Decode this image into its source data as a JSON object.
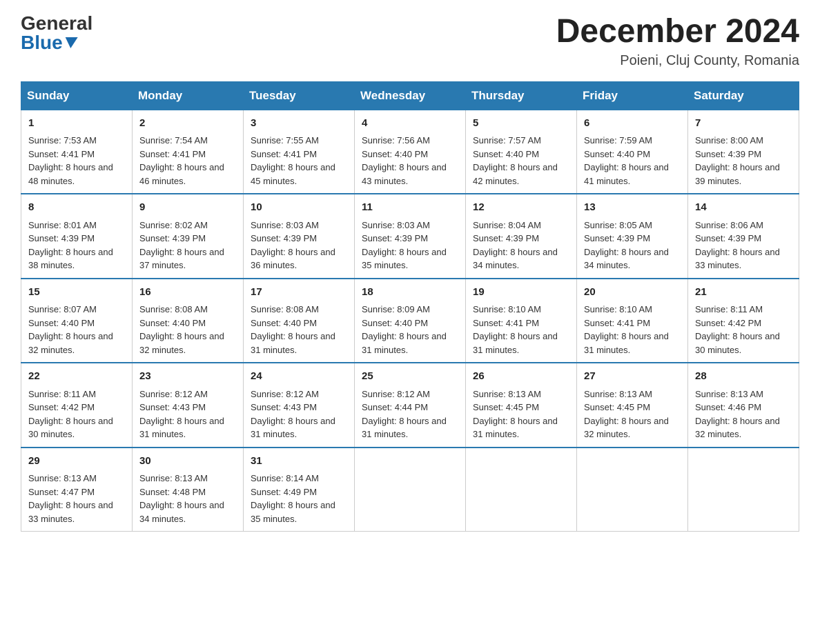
{
  "logo": {
    "general": "General",
    "blue": "Blue"
  },
  "header": {
    "month_year": "December 2024",
    "location": "Poieni, Cluj County, Romania"
  },
  "days_of_week": [
    "Sunday",
    "Monday",
    "Tuesday",
    "Wednesday",
    "Thursday",
    "Friday",
    "Saturday"
  ],
  "weeks": [
    [
      {
        "day": "1",
        "sunrise": "Sunrise: 7:53 AM",
        "sunset": "Sunset: 4:41 PM",
        "daylight": "Daylight: 8 hours and 48 minutes."
      },
      {
        "day": "2",
        "sunrise": "Sunrise: 7:54 AM",
        "sunset": "Sunset: 4:41 PM",
        "daylight": "Daylight: 8 hours and 46 minutes."
      },
      {
        "day": "3",
        "sunrise": "Sunrise: 7:55 AM",
        "sunset": "Sunset: 4:41 PM",
        "daylight": "Daylight: 8 hours and 45 minutes."
      },
      {
        "day": "4",
        "sunrise": "Sunrise: 7:56 AM",
        "sunset": "Sunset: 4:40 PM",
        "daylight": "Daylight: 8 hours and 43 minutes."
      },
      {
        "day": "5",
        "sunrise": "Sunrise: 7:57 AM",
        "sunset": "Sunset: 4:40 PM",
        "daylight": "Daylight: 8 hours and 42 minutes."
      },
      {
        "day": "6",
        "sunrise": "Sunrise: 7:59 AM",
        "sunset": "Sunset: 4:40 PM",
        "daylight": "Daylight: 8 hours and 41 minutes."
      },
      {
        "day": "7",
        "sunrise": "Sunrise: 8:00 AM",
        "sunset": "Sunset: 4:39 PM",
        "daylight": "Daylight: 8 hours and 39 minutes."
      }
    ],
    [
      {
        "day": "8",
        "sunrise": "Sunrise: 8:01 AM",
        "sunset": "Sunset: 4:39 PM",
        "daylight": "Daylight: 8 hours and 38 minutes."
      },
      {
        "day": "9",
        "sunrise": "Sunrise: 8:02 AM",
        "sunset": "Sunset: 4:39 PM",
        "daylight": "Daylight: 8 hours and 37 minutes."
      },
      {
        "day": "10",
        "sunrise": "Sunrise: 8:03 AM",
        "sunset": "Sunset: 4:39 PM",
        "daylight": "Daylight: 8 hours and 36 minutes."
      },
      {
        "day": "11",
        "sunrise": "Sunrise: 8:03 AM",
        "sunset": "Sunset: 4:39 PM",
        "daylight": "Daylight: 8 hours and 35 minutes."
      },
      {
        "day": "12",
        "sunrise": "Sunrise: 8:04 AM",
        "sunset": "Sunset: 4:39 PM",
        "daylight": "Daylight: 8 hours and 34 minutes."
      },
      {
        "day": "13",
        "sunrise": "Sunrise: 8:05 AM",
        "sunset": "Sunset: 4:39 PM",
        "daylight": "Daylight: 8 hours and 34 minutes."
      },
      {
        "day": "14",
        "sunrise": "Sunrise: 8:06 AM",
        "sunset": "Sunset: 4:39 PM",
        "daylight": "Daylight: 8 hours and 33 minutes."
      }
    ],
    [
      {
        "day": "15",
        "sunrise": "Sunrise: 8:07 AM",
        "sunset": "Sunset: 4:40 PM",
        "daylight": "Daylight: 8 hours and 32 minutes."
      },
      {
        "day": "16",
        "sunrise": "Sunrise: 8:08 AM",
        "sunset": "Sunset: 4:40 PM",
        "daylight": "Daylight: 8 hours and 32 minutes."
      },
      {
        "day": "17",
        "sunrise": "Sunrise: 8:08 AM",
        "sunset": "Sunset: 4:40 PM",
        "daylight": "Daylight: 8 hours and 31 minutes."
      },
      {
        "day": "18",
        "sunrise": "Sunrise: 8:09 AM",
        "sunset": "Sunset: 4:40 PM",
        "daylight": "Daylight: 8 hours and 31 minutes."
      },
      {
        "day": "19",
        "sunrise": "Sunrise: 8:10 AM",
        "sunset": "Sunset: 4:41 PM",
        "daylight": "Daylight: 8 hours and 31 minutes."
      },
      {
        "day": "20",
        "sunrise": "Sunrise: 8:10 AM",
        "sunset": "Sunset: 4:41 PM",
        "daylight": "Daylight: 8 hours and 31 minutes."
      },
      {
        "day": "21",
        "sunrise": "Sunrise: 8:11 AM",
        "sunset": "Sunset: 4:42 PM",
        "daylight": "Daylight: 8 hours and 30 minutes."
      }
    ],
    [
      {
        "day": "22",
        "sunrise": "Sunrise: 8:11 AM",
        "sunset": "Sunset: 4:42 PM",
        "daylight": "Daylight: 8 hours and 30 minutes."
      },
      {
        "day": "23",
        "sunrise": "Sunrise: 8:12 AM",
        "sunset": "Sunset: 4:43 PM",
        "daylight": "Daylight: 8 hours and 31 minutes."
      },
      {
        "day": "24",
        "sunrise": "Sunrise: 8:12 AM",
        "sunset": "Sunset: 4:43 PM",
        "daylight": "Daylight: 8 hours and 31 minutes."
      },
      {
        "day": "25",
        "sunrise": "Sunrise: 8:12 AM",
        "sunset": "Sunset: 4:44 PM",
        "daylight": "Daylight: 8 hours and 31 minutes."
      },
      {
        "day": "26",
        "sunrise": "Sunrise: 8:13 AM",
        "sunset": "Sunset: 4:45 PM",
        "daylight": "Daylight: 8 hours and 31 minutes."
      },
      {
        "day": "27",
        "sunrise": "Sunrise: 8:13 AM",
        "sunset": "Sunset: 4:45 PM",
        "daylight": "Daylight: 8 hours and 32 minutes."
      },
      {
        "day": "28",
        "sunrise": "Sunrise: 8:13 AM",
        "sunset": "Sunset: 4:46 PM",
        "daylight": "Daylight: 8 hours and 32 minutes."
      }
    ],
    [
      {
        "day": "29",
        "sunrise": "Sunrise: 8:13 AM",
        "sunset": "Sunset: 4:47 PM",
        "daylight": "Daylight: 8 hours and 33 minutes."
      },
      {
        "day": "30",
        "sunrise": "Sunrise: 8:13 AM",
        "sunset": "Sunset: 4:48 PM",
        "daylight": "Daylight: 8 hours and 34 minutes."
      },
      {
        "day": "31",
        "sunrise": "Sunrise: 8:14 AM",
        "sunset": "Sunset: 4:49 PM",
        "daylight": "Daylight: 8 hours and 35 minutes."
      },
      null,
      null,
      null,
      null
    ]
  ]
}
